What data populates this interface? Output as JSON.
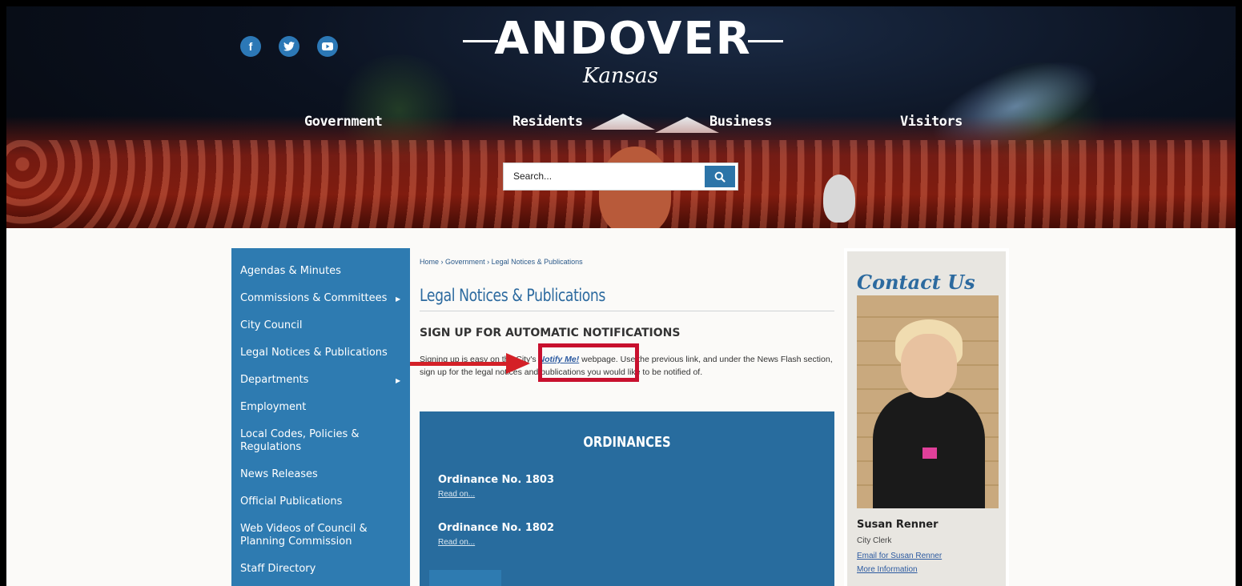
{
  "header": {
    "logo_word": "ANDOVER",
    "logo_sub": "Kansas",
    "social": [
      {
        "icon": "facebook-icon",
        "glyph": "f"
      },
      {
        "icon": "twitter-icon",
        "glyph": "t"
      },
      {
        "icon": "youtube-icon",
        "glyph": "▶"
      }
    ],
    "nav": [
      "Government",
      "Residents",
      "Business",
      "Visitors"
    ],
    "search": {
      "placeholder": "Search..."
    }
  },
  "sidebar": {
    "items": [
      {
        "label": "Agendas & Minutes",
        "arrow": false
      },
      {
        "label": "Commissions & Committees",
        "arrow": true
      },
      {
        "label": "City Council",
        "arrow": false
      },
      {
        "label": "Legal Notices & Publications",
        "arrow": false
      },
      {
        "label": "Departments",
        "arrow": true
      },
      {
        "label": "Employment",
        "arrow": false
      },
      {
        "label": "Local Codes, Policies & Regulations",
        "arrow": false
      },
      {
        "label": "News Releases",
        "arrow": false
      },
      {
        "label": "Official Publications",
        "arrow": false
      },
      {
        "label": "Web Videos of Council & Planning Commission",
        "arrow": false
      },
      {
        "label": "Staff Directory",
        "arrow": false
      }
    ]
  },
  "main": {
    "breadcrumb": {
      "home": "Home",
      "sep": "›",
      "section": "Government",
      "current": "Legal Notices & Publications"
    },
    "title": "Legal Notices & Publications",
    "section_heading": "SIGN UP FOR AUTOMATIC NOTIFICATIONS",
    "para_before": "Signing up is easy on the City's ",
    "para_link": "Notify Me!",
    "para_after": " webpage.  Use the previous link, and under the News Flash section, sign up for the legal notices and publications you would like to be notified of.",
    "ordinances": {
      "title": "ORDINANCES",
      "items": [
        {
          "name": "Ordinance No. 1803",
          "link": "Read on..."
        },
        {
          "name": "Ordinance No. 1802",
          "link": "Read on..."
        }
      ]
    }
  },
  "contact": {
    "title": "Contact Us",
    "name": "Susan Renner",
    "role": "City Clerk",
    "email_link": "Email for Susan Renner",
    "more_link": "More Information"
  },
  "colors": {
    "sidebar": "#2e7bb1",
    "accent": "#2c6a9f",
    "annotation_red": "#d42027"
  }
}
